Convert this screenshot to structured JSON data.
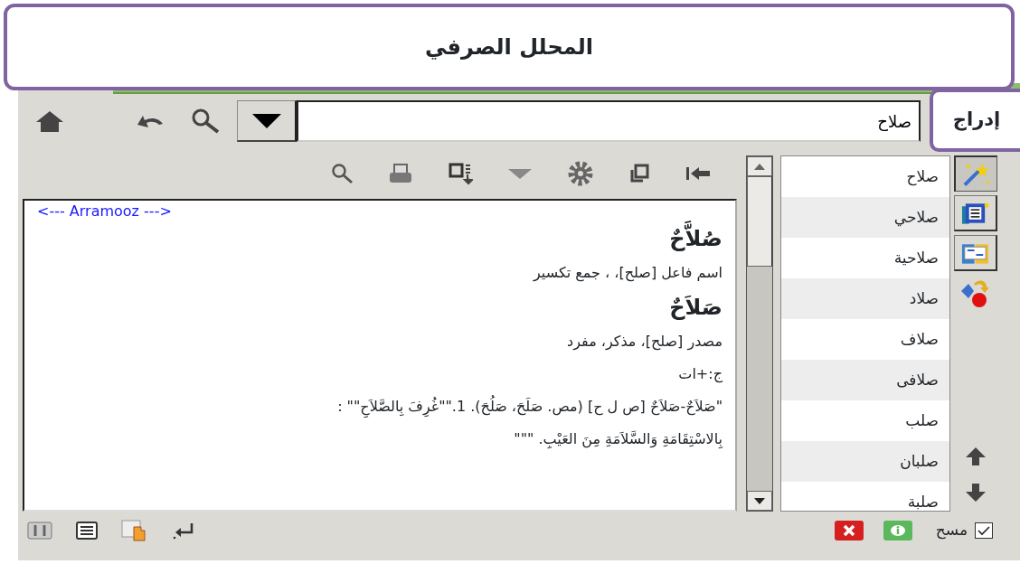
{
  "title": "المحلل الصرفي",
  "insert_callout": "إدراج",
  "search": {
    "value": "صلاح"
  },
  "result_lines": [
    {
      "kind": "source",
      "text": "<--- Arramooz --->"
    },
    {
      "kind": "word",
      "text": "صُلاَّحٌ"
    },
    {
      "kind": "info",
      "text": "اسم فاعل [صلح]، ، جمع تكسير"
    },
    {
      "kind": "word",
      "text": "صَلاَحٌ"
    },
    {
      "kind": "info",
      "text": "مصدر [صلح]، مذكر، مفرد"
    },
    {
      "kind": "info",
      "text": "ج:+ات"
    },
    {
      "kind": "definition",
      "text": "\"صَلاَحٌ-صَلاَحٌ [ص ل ح] (مص. صَلَحَ، صَلُحَ). 1.\"\"غُرِفَ بِالصَّلاَحِ\"\" : بِالاسْتِقَامَةِ وَالسَّلاَمَةِ مِنَ العَيْبِ. \"\"\""
    }
  ],
  "words": [
    {
      "text": "صلاح"
    },
    {
      "text": "صلاحي"
    },
    {
      "text": "صلاحية"
    },
    {
      "text": "صلاد"
    },
    {
      "text": "صلاف"
    },
    {
      "text": "صلافى"
    },
    {
      "text": "صلب"
    },
    {
      "text": "صلبان"
    },
    {
      "text": "صلبة"
    }
  ],
  "side_tools": [
    {
      "kind": "wand",
      "selected": true
    },
    {
      "kind": "list",
      "selected": false
    },
    {
      "kind": "book",
      "selected": false
    }
  ],
  "clear": {
    "label": "مسح",
    "checked": true
  }
}
